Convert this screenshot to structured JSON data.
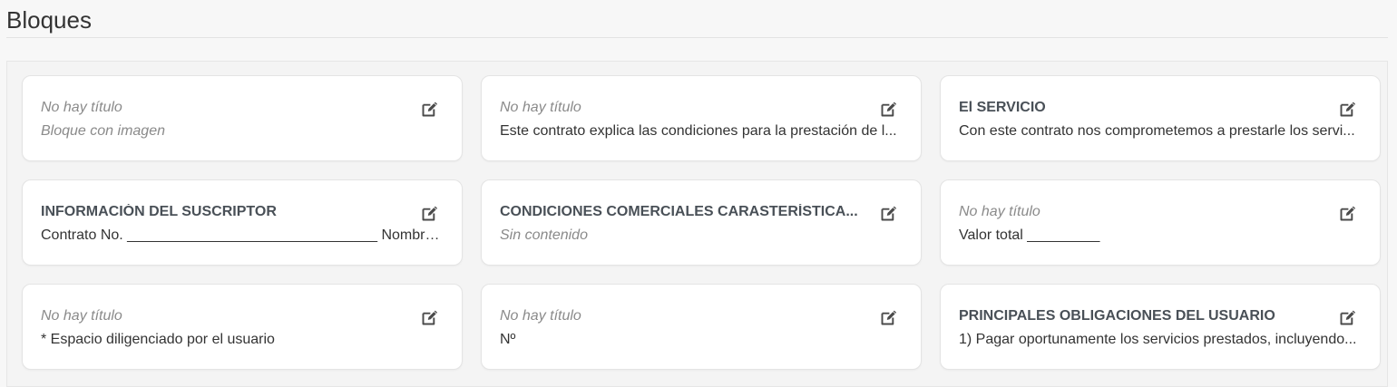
{
  "page": {
    "title": "Bloques"
  },
  "edit_icon": "edit-icon",
  "blocks": [
    {
      "title": "No hay título",
      "title_placeholder": true,
      "text": "Bloque con imagen",
      "text_placeholder": true
    },
    {
      "title": "No hay título",
      "title_placeholder": true,
      "text": "Este contrato explica las condiciones para la prestación de l...",
      "text_placeholder": false
    },
    {
      "title": "El SERVICIO",
      "title_placeholder": false,
      "text": "Con este contrato nos comprometemos a prestarle los servi...",
      "text_placeholder": false
    },
    {
      "title": "INFORMACIÓN DEL SUSCRIPTOR",
      "title_placeholder": false,
      "text": "Contrato No. _______________________________ Nombre / R...",
      "text_placeholder": false
    },
    {
      "title": "CONDICIONES COMERCIALES CARASTERÍSTICA...",
      "title_placeholder": false,
      "text": "Sin contenido",
      "text_placeholder": true
    },
    {
      "title": "No hay título",
      "title_placeholder": true,
      "text": "Valor total _________",
      "text_placeholder": false
    },
    {
      "title": "No hay título",
      "title_placeholder": true,
      "text": "* Espacio diligenciado por el usuario",
      "text_placeholder": false
    },
    {
      "title": "No hay título",
      "title_placeholder": true,
      "text": "Nº",
      "text_placeholder": false
    },
    {
      "title": "PRINCIPALES OBLIGACIONES DEL USUARIO",
      "title_placeholder": false,
      "text": "1) Pagar oportunamente los servicios prestados, incluyendo...",
      "text_placeholder": false
    }
  ]
}
